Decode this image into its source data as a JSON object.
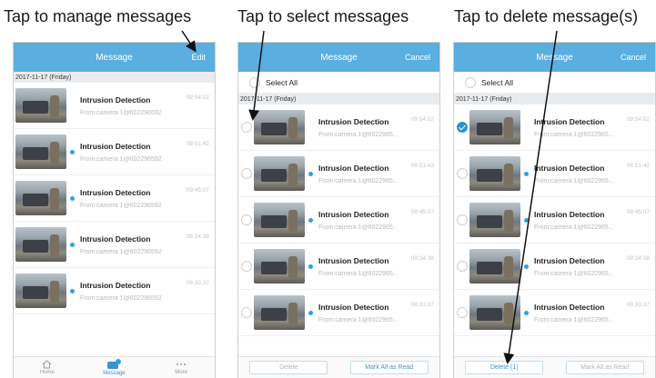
{
  "captions": {
    "manage": "Tap to manage messages",
    "select": "Tap to select messages",
    "delete": "Tap to delete message(s)"
  },
  "screen1": {
    "title": "Message",
    "edit": "Edit",
    "date": "2017-11-17 (Friday)",
    "messages": [
      {
        "title": "Intrusion Detection",
        "from": "From:camera 1@6022965​92",
        "time": "09:54:02",
        "unread": false
      },
      {
        "title": "Intrusion Detection",
        "from": "From:camera 1@602296592",
        "time": "09:51:42",
        "unread": true
      },
      {
        "title": "Intrusion Detection",
        "from": "From:camera 1@602296592",
        "time": "09:45:07",
        "unread": true
      },
      {
        "title": "Intrusion Detection",
        "from": "From:camera 1@602296592",
        "time": "09:34:38",
        "unread": true
      },
      {
        "title": "Intrusion Detection",
        "from": "From:camera 1@602296592",
        "time": "09:33:37",
        "unread": true
      }
    ],
    "tabs": [
      "Home",
      "Message",
      "More"
    ]
  },
  "screen2": {
    "title": "Message",
    "cancel": "Cancel",
    "select_all": "Select All",
    "date": "2017-11-17 (Friday)",
    "messages": [
      {
        "title": "Intrusion Detection",
        "from": "From:camera 1@6022965...",
        "time": "09:54:02",
        "unread": false,
        "checked": false
      },
      {
        "title": "Intrusion Detection",
        "from": "From:camera 1@6022965...",
        "time": "09:51:43",
        "unread": true,
        "checked": false
      },
      {
        "title": "Intrusion Detection",
        "from": "From:camera 1@6022965...",
        "time": "09:45:07",
        "unread": true,
        "checked": false
      },
      {
        "title": "Intrusion Detection",
        "from": "From:camera 1@6022965...",
        "time": "09:34:38",
        "unread": true,
        "checked": false
      },
      {
        "title": "Intrusion Detection",
        "from": "From:camera 1@6022965...",
        "time": "09:33:37",
        "unread": true,
        "checked": false
      }
    ],
    "delete": "Delete",
    "mark_all": "Mark All as Read"
  },
  "screen3": {
    "title": "Message",
    "cancel": "Cancel",
    "select_all": "Select All",
    "date": "2017-11-17 (Friday)",
    "messages": [
      {
        "title": "Intrusion Detection",
        "from": "From:camera 1@6022965...",
        "time": "09:54:02",
        "unread": false,
        "checked": true
      },
      {
        "title": "Intrusion Detection",
        "from": "From:camera 1@6022965...",
        "time": "09:51:42",
        "unread": true,
        "checked": false
      },
      {
        "title": "Intrusion Detection",
        "from": "From:camera 1@6022965...",
        "time": "09:45:07",
        "unread": true,
        "checked": false
      },
      {
        "title": "Intrusion Detection",
        "from": "From:camera 1@6022965...",
        "time": "09:34:38",
        "unread": true,
        "checked": false
      },
      {
        "title": "Intrusion Detection",
        "from": "From:camera 1@6022965...",
        "time": "09:33:37",
        "unread": true,
        "checked": false
      }
    ],
    "delete": "Delete  (1)",
    "mark_all": "Mark All as Read"
  },
  "colors": {
    "header": "#5aaee0",
    "accent": "#2a93d5",
    "unread_dot": "#2aa3e0"
  }
}
